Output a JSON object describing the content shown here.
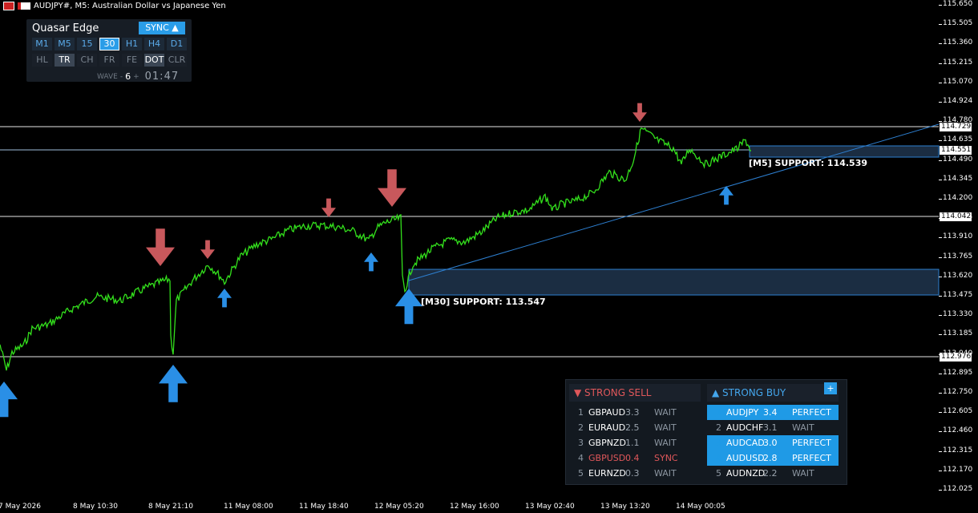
{
  "window": {
    "title": "AUDJPY#, M5:  Australian Dollar vs Japanese Yen"
  },
  "indicator_panel": {
    "title": "Quasar Edge",
    "sync_label": "SYNC ▲",
    "timeframes": [
      "M1",
      "M5",
      "15",
      "30",
      "H1",
      "H4",
      "D1"
    ],
    "active_timeframe": "30",
    "tools": [
      "HL",
      "TR",
      "CH",
      "FR",
      "FE",
      "DOT",
      "CLR"
    ],
    "active_tools": [
      "TR",
      "DOT"
    ],
    "wave_label": "WAVE",
    "wave_minus": "-",
    "wave_value": "6",
    "wave_plus": "+",
    "countdown": "01:47"
  },
  "price_axis": {
    "ticks": [
      "115.650",
      "115.505",
      "115.360",
      "115.215",
      "115.070",
      "114.924",
      "114.780",
      "114.635",
      "114.490",
      "114.345",
      "114.200",
      "114.055",
      "113.910",
      "113.765",
      "113.620",
      "113.475",
      "113.330",
      "113.185",
      "113.040",
      "112.895",
      "112.750",
      "112.605",
      "112.460",
      "112.315",
      "112.170",
      "112.025"
    ],
    "tags": [
      "114.729",
      "114.551",
      "114.042",
      "112.976"
    ]
  },
  "time_axis": [
    "7 May 2026",
    "8 May 10:30",
    "8 May 21:10",
    "11 May 08:00",
    "11 May 18:40",
    "12 May 05:20",
    "12 May 16:00",
    "13 May 02:40",
    "13 May 13:20",
    "14 May 00:05"
  ],
  "annotations": {
    "m30_support": "[M30] SUPPORT: 113.547",
    "m5_support": "[M5] SUPPORT: 114.539"
  },
  "scanner": {
    "sell_header": "▼ STRONG SELL",
    "buy_header": "▲ STRONG BUY",
    "add_label": "+",
    "sell": [
      {
        "idx": "1",
        "sym": "GBPAUD",
        "val": "3.3",
        "status": "WAIT"
      },
      {
        "idx": "2",
        "sym": "EURAUD",
        "val": "2.5",
        "status": "WAIT"
      },
      {
        "idx": "3",
        "sym": "GBPNZD",
        "val": "1.1",
        "status": "WAIT"
      },
      {
        "idx": "4",
        "sym": "GBPUSD",
        "val": "0.4",
        "status": "SYNC"
      },
      {
        "idx": "5",
        "sym": "EURNZD",
        "val": "0.3",
        "status": "WAIT"
      }
    ],
    "buy": [
      {
        "idx": "1",
        "sym": "AUDJPY",
        "val": "3.4",
        "status": "PERFECT"
      },
      {
        "idx": "2",
        "sym": "AUDCHF",
        "val": "3.1",
        "status": "WAIT"
      },
      {
        "idx": "3",
        "sym": "AUDCAD",
        "val": "3.0",
        "status": "PERFECT"
      },
      {
        "idx": "4",
        "sym": "AUDUSD",
        "val": "2.8",
        "status": "PERFECT"
      },
      {
        "idx": "5",
        "sym": "AUDNZD",
        "val": "2.2",
        "status": "WAIT"
      }
    ]
  },
  "colors": {
    "price": "#33e01c",
    "buy_arrow": "#2a8fe6",
    "sell_arrow": "#c8585c",
    "zone": "#1b2d42",
    "trendline": "#2d7fd0"
  }
}
